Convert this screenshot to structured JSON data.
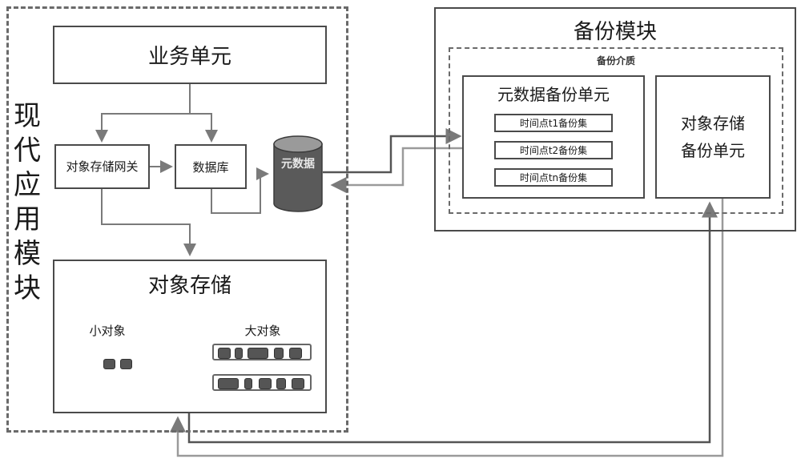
{
  "modern_app_module": {
    "label": "现代应用模块",
    "business_unit": "业务单元",
    "object_storage_gateway": "对象存储网关",
    "database": "数据库",
    "metadata": "元数据",
    "object_storage": {
      "title": "对象存储",
      "small_objects_label": "小对象",
      "large_objects_label": "大对象"
    }
  },
  "backup_module": {
    "title": "备份模块",
    "backup_medium": "备份介质",
    "metadata_backup_unit": {
      "title": "元数据备份单元",
      "sets": [
        "时间点t1备份集",
        "时间点t2备份集",
        "时间点tn备份集"
      ]
    },
    "object_storage_backup_unit": "对象存储备份单元"
  },
  "colors": {
    "line": "#7a7a7a",
    "border": "#4a4a4a",
    "cylinder": "#5a5a5a",
    "cylinder_top": "#9a9a9a"
  }
}
